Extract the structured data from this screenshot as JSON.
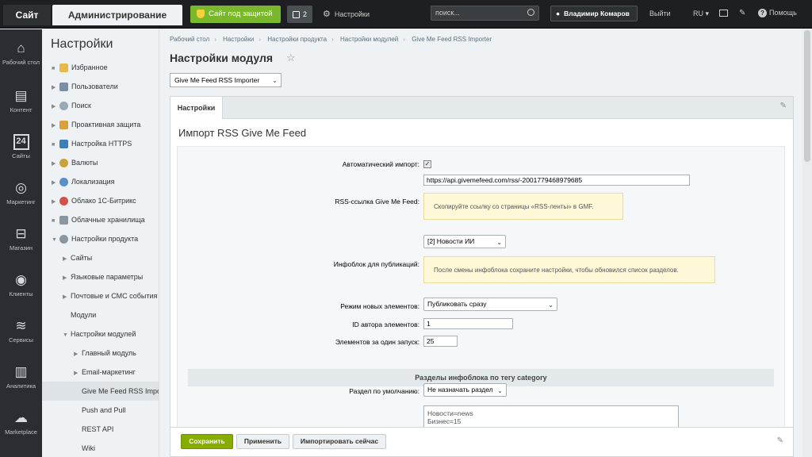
{
  "topbar": {
    "site_tab": "Сайт",
    "admin_tab": "Администрирование",
    "secure_label": "Сайт под защитой",
    "notifications_count": "2",
    "settings_label": "Настройки",
    "search_placeholder": "поиск...",
    "user_name": "Владимир Комаров",
    "logout_label": "Выйти",
    "language": "RU",
    "help_label": "Помощь"
  },
  "rail": {
    "items": [
      {
        "label": "Рабочий стол",
        "icon": "home-icon"
      },
      {
        "label": "Контент",
        "icon": "document-icon"
      },
      {
        "label": "Сайты",
        "icon": "calendar-icon"
      },
      {
        "label": "Маркетинг",
        "icon": "target-icon"
      },
      {
        "label": "Магазин",
        "icon": "cart-icon"
      },
      {
        "label": "Клиенты",
        "icon": "clients-icon"
      },
      {
        "label": "Сервисы",
        "icon": "layers-icon"
      },
      {
        "label": "Аналитика",
        "icon": "bar-chart-icon"
      },
      {
        "label": "Marketplace",
        "icon": "cloud-download-icon"
      }
    ]
  },
  "sidebar": {
    "title": "Настройки",
    "items": [
      {
        "label": "Избранное"
      },
      {
        "label": "Пользователи"
      },
      {
        "label": "Поиск"
      },
      {
        "label": "Проактивная защита"
      },
      {
        "label": "Настройка HTTPS"
      },
      {
        "label": "Валюты"
      },
      {
        "label": "Локализация"
      },
      {
        "label": "Облако 1С-Битрикс"
      },
      {
        "label": "Облачные хранилища"
      },
      {
        "label": "Настройки продукта"
      },
      {
        "label": "Сайты"
      },
      {
        "label": "Языковые параметры"
      },
      {
        "label": "Почтовые и СМС события"
      },
      {
        "label": "Модули"
      },
      {
        "label": "Настройки модулей"
      },
      {
        "label": "Главный модуль"
      },
      {
        "label": "Email-маркетинг"
      },
      {
        "label": "Give Me Feed RSS Importer"
      },
      {
        "label": "Push and Pull"
      },
      {
        "label": "REST API"
      },
      {
        "label": "Wiki"
      }
    ]
  },
  "breadcrumb": [
    "Рабочий стол",
    "Настройки",
    "Настройки продукта",
    "Настройки модулей",
    "Give Me Feed RSS Importer"
  ],
  "page": {
    "title": "Настройки модуля",
    "module_select": "Give Me Feed RSS Importer",
    "tab_label": "Настройки",
    "panel_heading": "Импорт RSS Give Me Feed"
  },
  "form": {
    "auto_import_label": "Автоматический импорт:",
    "rss_url": "https://api.givemefeed.com/rss/-2001779468979685",
    "rss_label": "RSS-ссылка Give Me Feed:",
    "rss_note": "Скопируйте ссылку со страницы «RSS-ленты» в GMF.",
    "iblock_select": "[2] Новости ИИ",
    "iblock_label": "Инфоблок для публикаций:",
    "iblock_note": "После смены инфоблока сохраните настройки, чтобы обновился список разделов.",
    "mode_label": "Режим новых элементов:",
    "mode_value": "Публиковать сразу",
    "author_label": "ID автора элементов:",
    "author_value": "1",
    "batch_label": "Элементов за один запуск:",
    "batch_value": "25",
    "section_heading": "Разделы инфоблока по тегу category",
    "default_section_label": "Раздел по умолчанию:",
    "default_section_value": "Не назначать раздел",
    "mapping_text": "Новости=news\nБизнес=15"
  },
  "footer": {
    "save": "Сохранить",
    "apply": "Применить",
    "import_now": "Импортировать сейчас"
  }
}
